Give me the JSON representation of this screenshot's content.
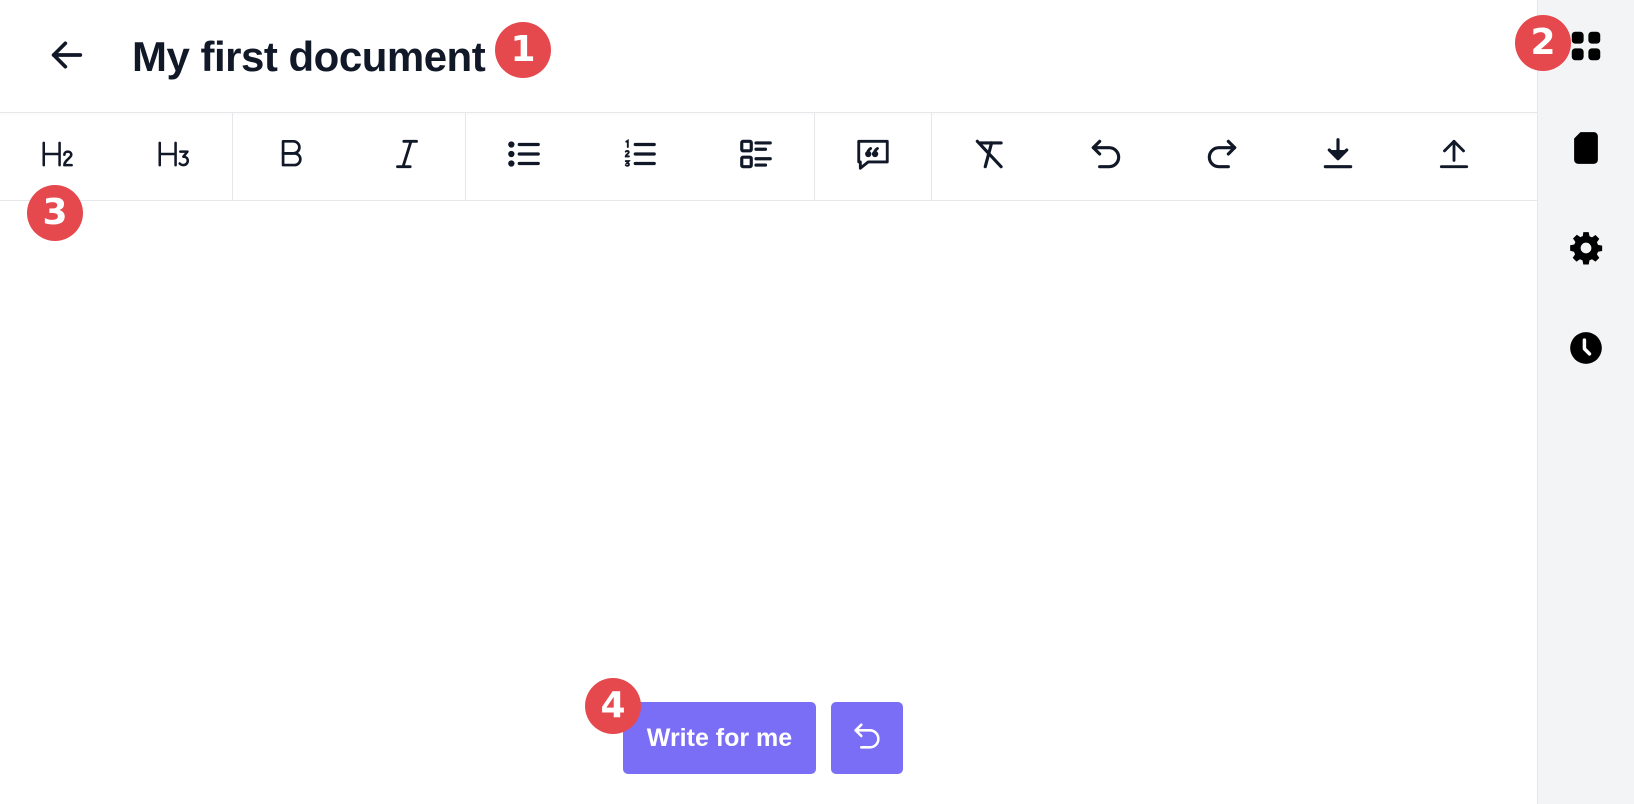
{
  "header": {
    "back_icon": "arrow-left-icon",
    "title": "My first document"
  },
  "toolbar": {
    "groups": [
      [
        {
          "id": "h2",
          "icon": "heading-2-icon",
          "label": "H2"
        },
        {
          "id": "h3",
          "icon": "heading-3-icon",
          "label": "H3"
        }
      ],
      [
        {
          "id": "bold",
          "icon": "bold-icon",
          "label": "B"
        },
        {
          "id": "italic",
          "icon": "italic-icon",
          "label": "I"
        }
      ],
      [
        {
          "id": "bullet-list",
          "icon": "bullet-list-icon"
        },
        {
          "id": "ordered-list",
          "icon": "ordered-list-icon"
        },
        {
          "id": "task-list",
          "icon": "task-list-icon"
        }
      ],
      [
        {
          "id": "quote",
          "icon": "quote-icon"
        }
      ],
      [
        {
          "id": "clear-format",
          "icon": "clear-format-icon"
        },
        {
          "id": "undo",
          "icon": "undo-icon"
        },
        {
          "id": "redo",
          "icon": "redo-icon"
        },
        {
          "id": "download",
          "icon": "download-icon"
        },
        {
          "id": "upload",
          "icon": "upload-icon"
        }
      ]
    ]
  },
  "sidebar": {
    "items": [
      {
        "id": "apps",
        "icon": "grid-icon"
      },
      {
        "id": "document",
        "icon": "document-icon"
      },
      {
        "id": "settings",
        "icon": "gear-icon"
      },
      {
        "id": "history",
        "icon": "clock-icon"
      }
    ]
  },
  "badges": [
    "1",
    "2",
    "3",
    "4"
  ],
  "actions": {
    "write_label": "Write for me",
    "undo_icon": "undo-icon"
  },
  "colors": {
    "accent": "#7b6ef6",
    "badge": "#e5484d",
    "text": "#111827",
    "sidebar_bg": "#f3f4f6",
    "border": "#e5e7eb"
  }
}
